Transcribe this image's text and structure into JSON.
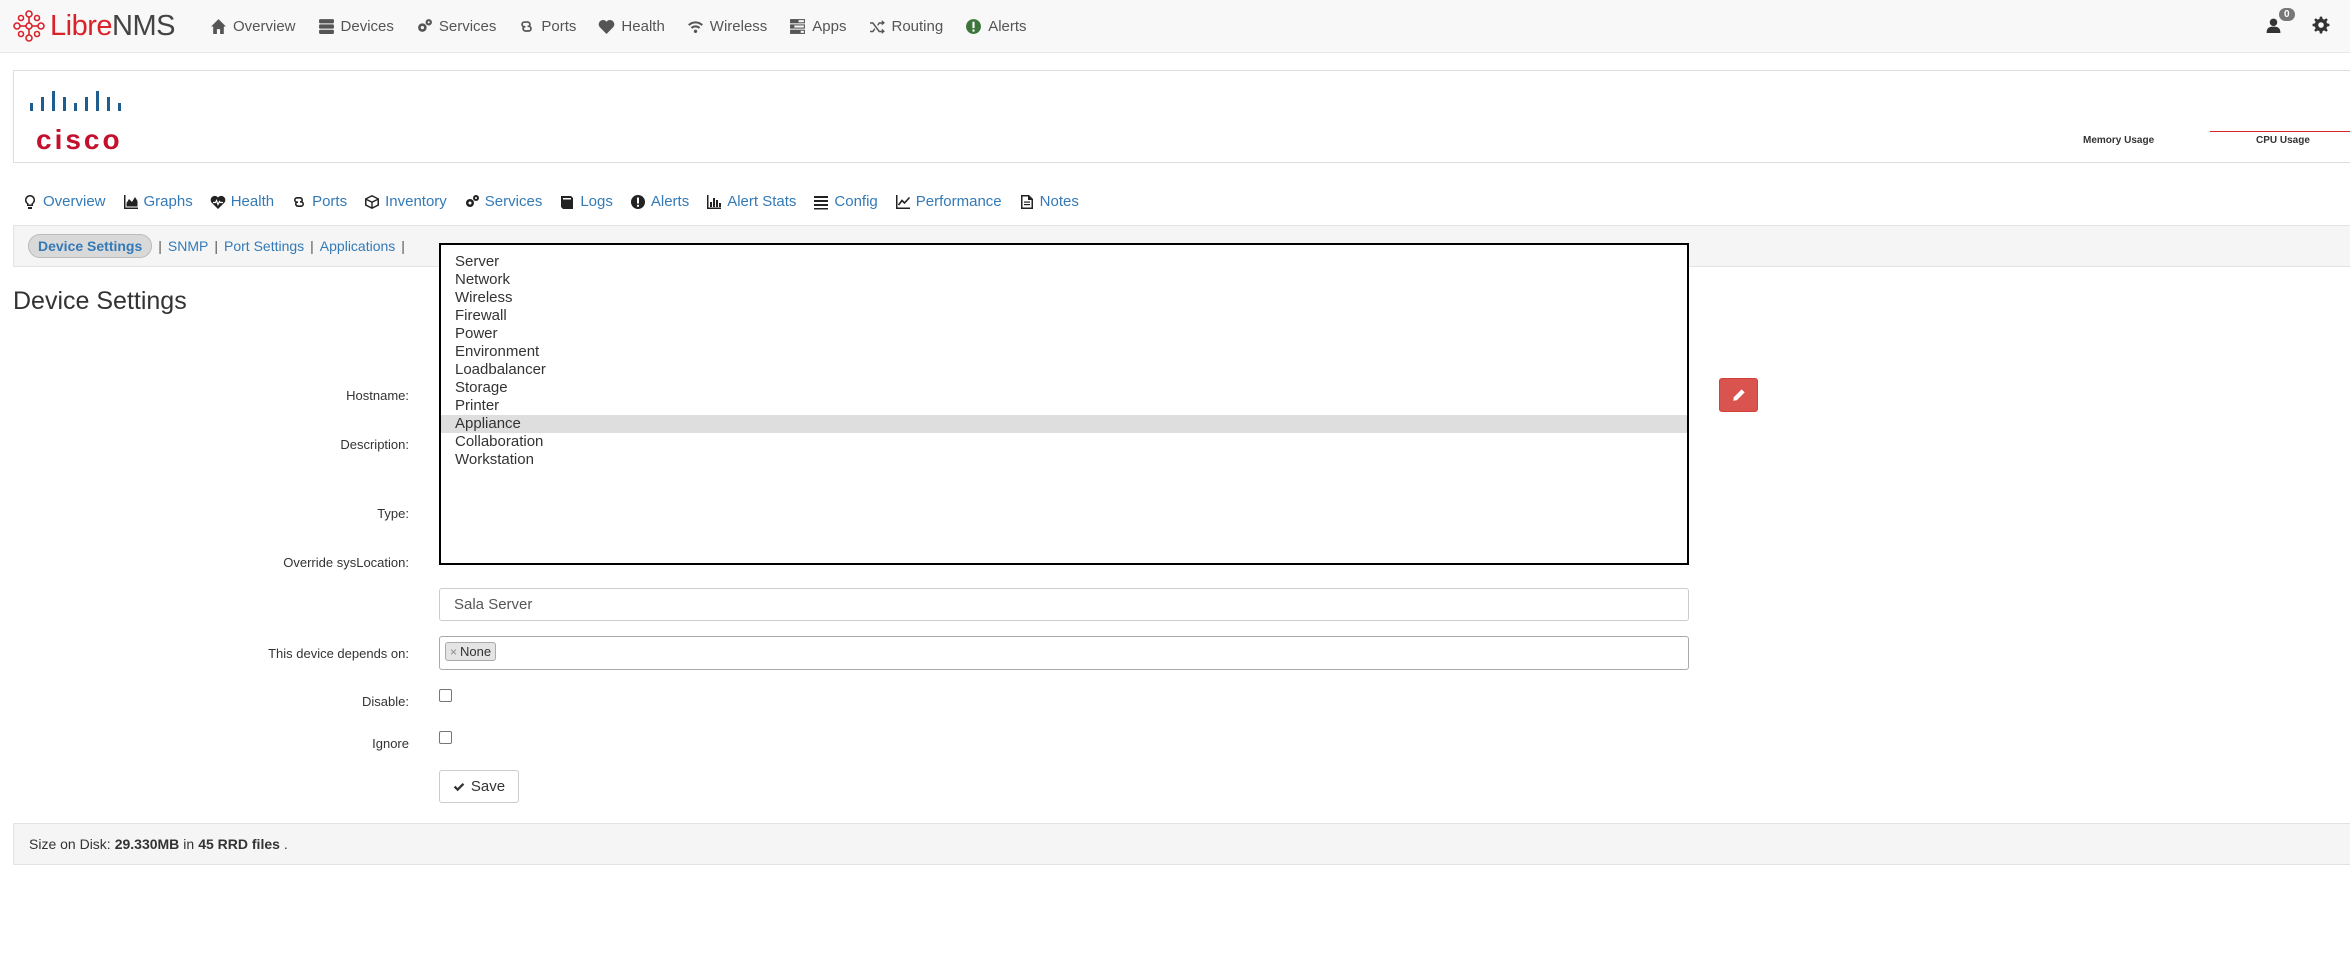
{
  "topnav": {
    "brand_libre": "Libre",
    "brand_nms": "NMS",
    "items": [
      {
        "label": "Overview",
        "icon": "home-icon"
      },
      {
        "label": "Devices",
        "icon": "server-icon"
      },
      {
        "label": "Services",
        "icon": "cogs-icon"
      },
      {
        "label": "Ports",
        "icon": "link-icon"
      },
      {
        "label": "Health",
        "icon": "heartbeat-icon"
      },
      {
        "label": "Wireless",
        "icon": "wifi-icon"
      },
      {
        "label": "Apps",
        "icon": "tasks-icon"
      },
      {
        "label": "Routing",
        "icon": "random-icon"
      },
      {
        "label": "Alerts",
        "icon": "exclamation-circle-icon"
      }
    ],
    "notification_count": "0"
  },
  "device": {
    "vendor_logo": "cisco",
    "memory_label": "Memory Usage",
    "cpu_label": "CPU Usage"
  },
  "device_tabs": [
    {
      "label": "Overview",
      "icon": "lightbulb-icon"
    },
    {
      "label": "Graphs",
      "icon": "area-chart-icon"
    },
    {
      "label": "Health",
      "icon": "heartbeat-icon"
    },
    {
      "label": "Ports",
      "icon": "link-icon"
    },
    {
      "label": "Inventory",
      "icon": "cube-icon"
    },
    {
      "label": "Services",
      "icon": "cogs-icon"
    },
    {
      "label": "Logs",
      "icon": "book-icon"
    },
    {
      "label": "Alerts",
      "icon": "exclamation-circle-icon"
    },
    {
      "label": "Alert Stats",
      "icon": "bar-chart-icon"
    },
    {
      "label": "Config",
      "icon": "align-justify-icon"
    },
    {
      "label": "Performance",
      "icon": "line-chart-icon"
    },
    {
      "label": "Notes",
      "icon": "file-text-icon"
    }
  ],
  "subnav": {
    "active": "Device Settings",
    "links": [
      "SNMP",
      "Port Settings",
      "Applications"
    ]
  },
  "page_title": "Device Settings",
  "form": {
    "hostname_label": "Hostname:",
    "description_label": "Description:",
    "type_label": "Type:",
    "override_label": "Override sysLocation:",
    "location_value": "Sala Server",
    "depends_label": "This device depends on:",
    "depends_tag": "None",
    "disable_label": "Disable:",
    "ignore_label": "Ignore",
    "save_label": "Save"
  },
  "type_dropdown": {
    "options": [
      "Server",
      "Network",
      "Wireless",
      "Firewall",
      "Power",
      "Environment",
      "Loadbalancer",
      "Storage",
      "Printer",
      "Appliance",
      "Collaboration",
      "Workstation"
    ],
    "highlighted": "Appliance"
  },
  "footer": {
    "size_prefix": "Size on Disk:",
    "size_value": "29.330MB",
    "in_word": "in",
    "files_value": "45 RRD files",
    "period": "."
  },
  "colors": {
    "brand_red": "#d9222a",
    "link_blue": "#337ab7",
    "danger": "#d9534f"
  }
}
